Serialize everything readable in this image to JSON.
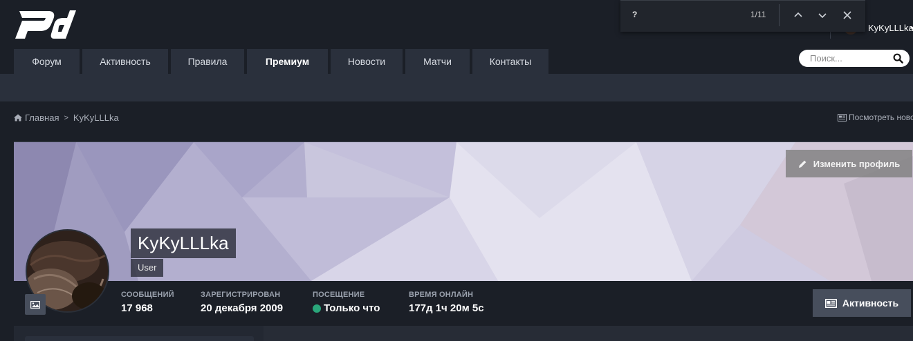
{
  "header": {
    "logo_text": "pd",
    "nav": [
      {
        "label": "Форум",
        "bold": false
      },
      {
        "label": "Активность",
        "bold": false
      },
      {
        "label": "Правила",
        "bold": false
      },
      {
        "label": "Премиум",
        "bold": true
      },
      {
        "label": "Новости",
        "bold": false
      },
      {
        "label": "Матчи",
        "bold": false
      },
      {
        "label": "Контакты",
        "bold": false
      }
    ],
    "search_placeholder": "Поиск...",
    "username": "KyKyLLLka"
  },
  "find_bar": {
    "query": "?",
    "count": "1/11"
  },
  "breadcrumb": {
    "home": "Главная",
    "current": "KyKyLLLka",
    "view_new": "Посмотреть новое"
  },
  "profile": {
    "name": "KyKyLLLka",
    "group": "User",
    "edit_label": "Изменить профиль",
    "activity_label": "Активность",
    "stats": [
      {
        "label": "СООБЩЕНИЙ",
        "value": "17 968"
      },
      {
        "label": "ЗАРЕГИСТРИРОВАН",
        "value": "20 декабря 2009"
      },
      {
        "label": "ПОСЕЩЕНИЕ",
        "value": "Только что"
      },
      {
        "label": "ВРЕМЯ ОНЛАЙН",
        "value": "177д 1ч 20м 5с"
      }
    ]
  },
  "colors": {
    "background": "#1b1f27",
    "nav_tab": "#2a303c",
    "online": "#2aa67a",
    "button": "#474e5c"
  }
}
